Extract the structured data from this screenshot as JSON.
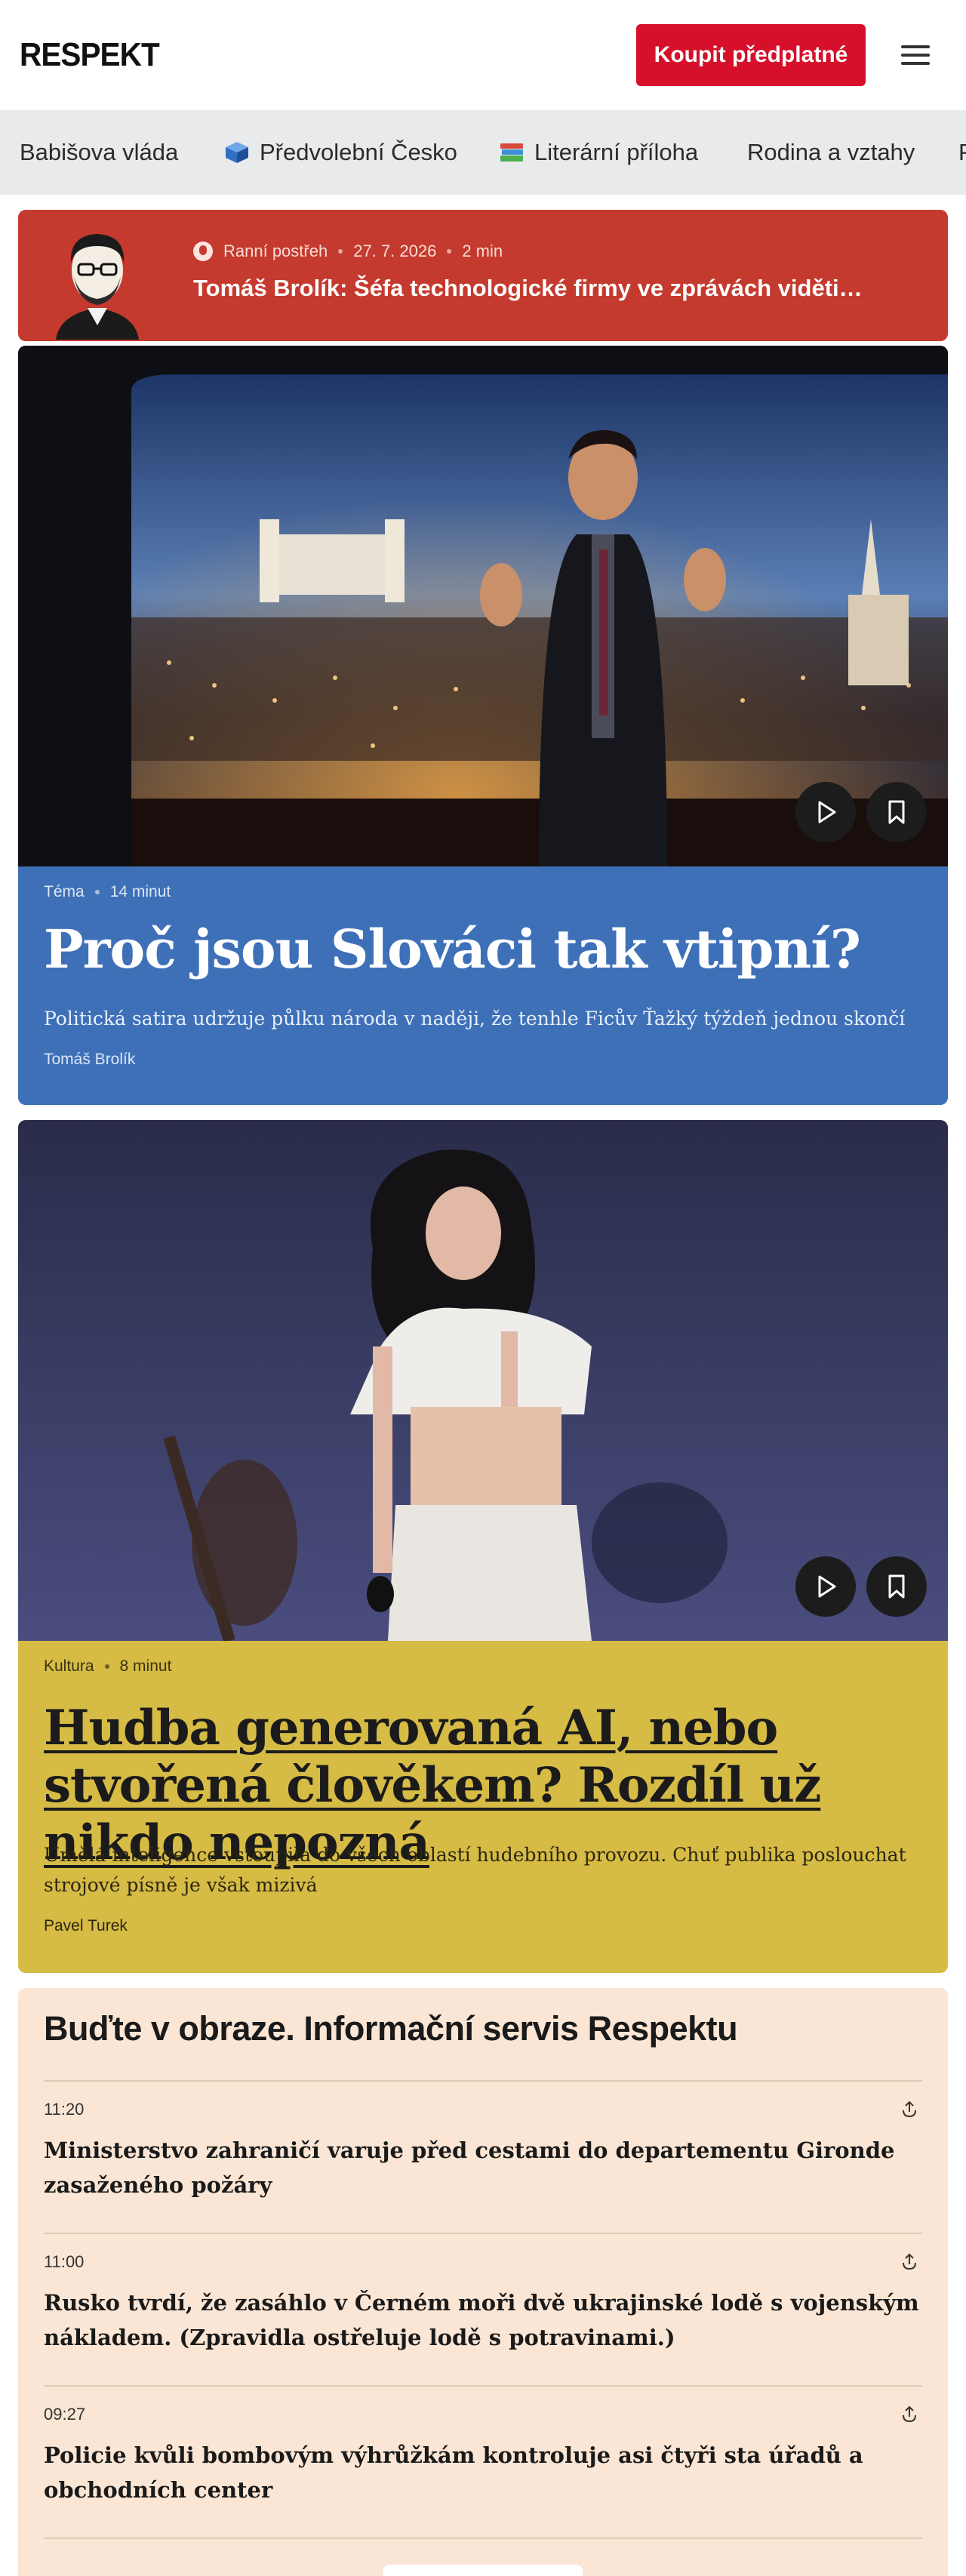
{
  "header": {
    "logo": "RESPEKT",
    "subscribe_label": "Koupit předplatné",
    "menu_icon": "hamburger-icon"
  },
  "topics": [
    {
      "label": "Babišova vláda",
      "icon": ""
    },
    {
      "label": "Předvolební Česko",
      "icon": "ballot-box-icon"
    },
    {
      "label": "Literární příloha",
      "icon": "books-icon"
    },
    {
      "label": "Rodina a vztahy",
      "icon": ""
    },
    {
      "label": "P",
      "icon": ""
    }
  ],
  "podcast": {
    "show": "Ranní postřeh",
    "date": "27. 7. 2026",
    "duration": "2 min",
    "title": "Tomáš Brolík: Šéfa technologické firmy ve zprávách viděti…"
  },
  "articles": [
    {
      "section": "Téma",
      "read_time": "14 minut",
      "headline": "Proč jsou Slováci tak vtipní?",
      "perex": "Politická satira udržuje půlku národa v naději, že tenhle Ficův Ťažký týždeň jednou skončí",
      "author": "Tomáš Brolík",
      "color": "#3e70b8"
    },
    {
      "section": "Kultura",
      "read_time": "8 minut",
      "headline": "Hudba generovaná AI, nebo stvořená člověkem? Rozdíl už nikdo nepozná",
      "perex": "Umělá inteligence vstoupila do všech oblastí hudebního provozu. Chuť publika poslouchat strojové písně je však mizivá",
      "author": "Pavel Turek",
      "color": "#d6bb45"
    }
  ],
  "newsbox": {
    "title": "Buďte v obraze. Informační servis Respektu",
    "items": [
      {
        "time": "11:20",
        "title": "Ministerstvo zahraničí varuje před cestami do departementu Gironde zasaženého požáry"
      },
      {
        "time": "11:00",
        "title": "Rusko tvrdí, že zasáhlo v Černém moři dvě ukrajinské lodě s vojenským nákladem. (Zpravidla ostřeluje lodě s potravinami.)"
      },
      {
        "time": "09:27",
        "title": "Policie kvůli bombovým výhrůžkám kontroluje asi čtyři sta úřadů a obchodních center"
      }
    ]
  }
}
